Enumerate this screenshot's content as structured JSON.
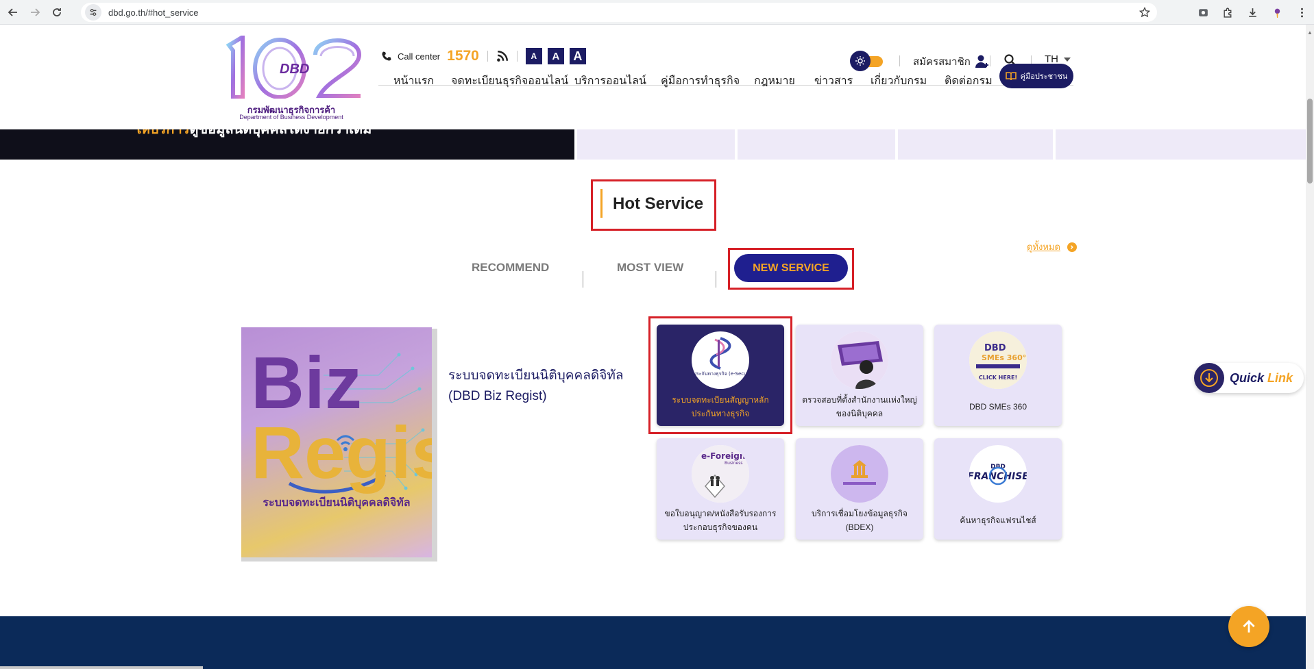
{
  "browser": {
    "url": "dbd.go.th/#hot_service"
  },
  "header": {
    "logo_number": "102",
    "logo_badge": "DBD",
    "logo_th": "กรมพัฒนาธุรกิจการค้า",
    "logo_en": "Department of Business Development",
    "call_center_label": "Call center",
    "call_center_number": "1570",
    "font_sizes": [
      "A",
      "A",
      "A"
    ],
    "register_label": "สมัครสมาชิก",
    "language": "TH"
  },
  "nav": {
    "items": [
      "หน้าแรก",
      "จดทะเบียนธุรกิจออนไลน์",
      "บริการออนไลน์",
      "คู่มือการทำธุรกิจ",
      "กฎหมาย",
      "ข่าวสาร",
      "เกี่ยวกับกรม",
      "ติดต่อกรม"
    ],
    "guide_label": "คู่มือประชาชน"
  },
  "banner": {
    "highlight": "ให้บริการ",
    "text": "ดูข้อมูลนิติบุคคลได้ง่ายกว่าเดิม"
  },
  "section": {
    "title": "Hot Service",
    "view_all": "ดูทั้งหมด"
  },
  "tabs": [
    {
      "label": "RECOMMEND",
      "active": false
    },
    {
      "label": "MOST VIEW",
      "active": false
    },
    {
      "label": "NEW SERVICE",
      "active": true
    }
  ],
  "featured": {
    "image_text_b": "Biz",
    "image_text_r": "Regist",
    "image_caption": "ระบบจดทะเบียนนิติบุคคลดิจิทัล",
    "title": "ระบบจดทะเบียนนิติบุคคลดิจิทัล (DBD Biz Regist)"
  },
  "services": [
    {
      "label": "ระบบจดทะเบียนสัญญาหลักประกันทางธุรกิจ",
      "icon_text": "หลักประกันทางธุรกิจ (e-Secured)",
      "active": true
    },
    {
      "label": "ตรวจสอบที่ตั้งสำนักงานแห่งใหญ่ของนิติบุคคล",
      "icon_text": "",
      "active": false
    },
    {
      "label": "DBD SMEs 360",
      "icon_text": "DBD SMEs 360° CLICK HERE!",
      "active": false
    },
    {
      "label": "ขอใบอนุญาต/หนังสือรับรองการประกอบธุรกิจของคน",
      "icon_text": "e-Foreign Business",
      "active": false
    },
    {
      "label": "บริการเชื่อมโยงข้อมูลธุรกิจ (BDEX)",
      "icon_text": "",
      "active": false
    },
    {
      "label": "ค้นหาธุรกิจแฟรนไชส์",
      "icon_text": "DBD FRANCHISE",
      "active": false
    }
  ],
  "quick_link": {
    "word1": "Quick",
    "word2": "Link"
  },
  "colors": {
    "navy": "#1c1c63",
    "accent": "#f4a425",
    "highlight_box": "#d62027",
    "card_bg": "#e8e3f8",
    "footer": "#0b2a59"
  }
}
